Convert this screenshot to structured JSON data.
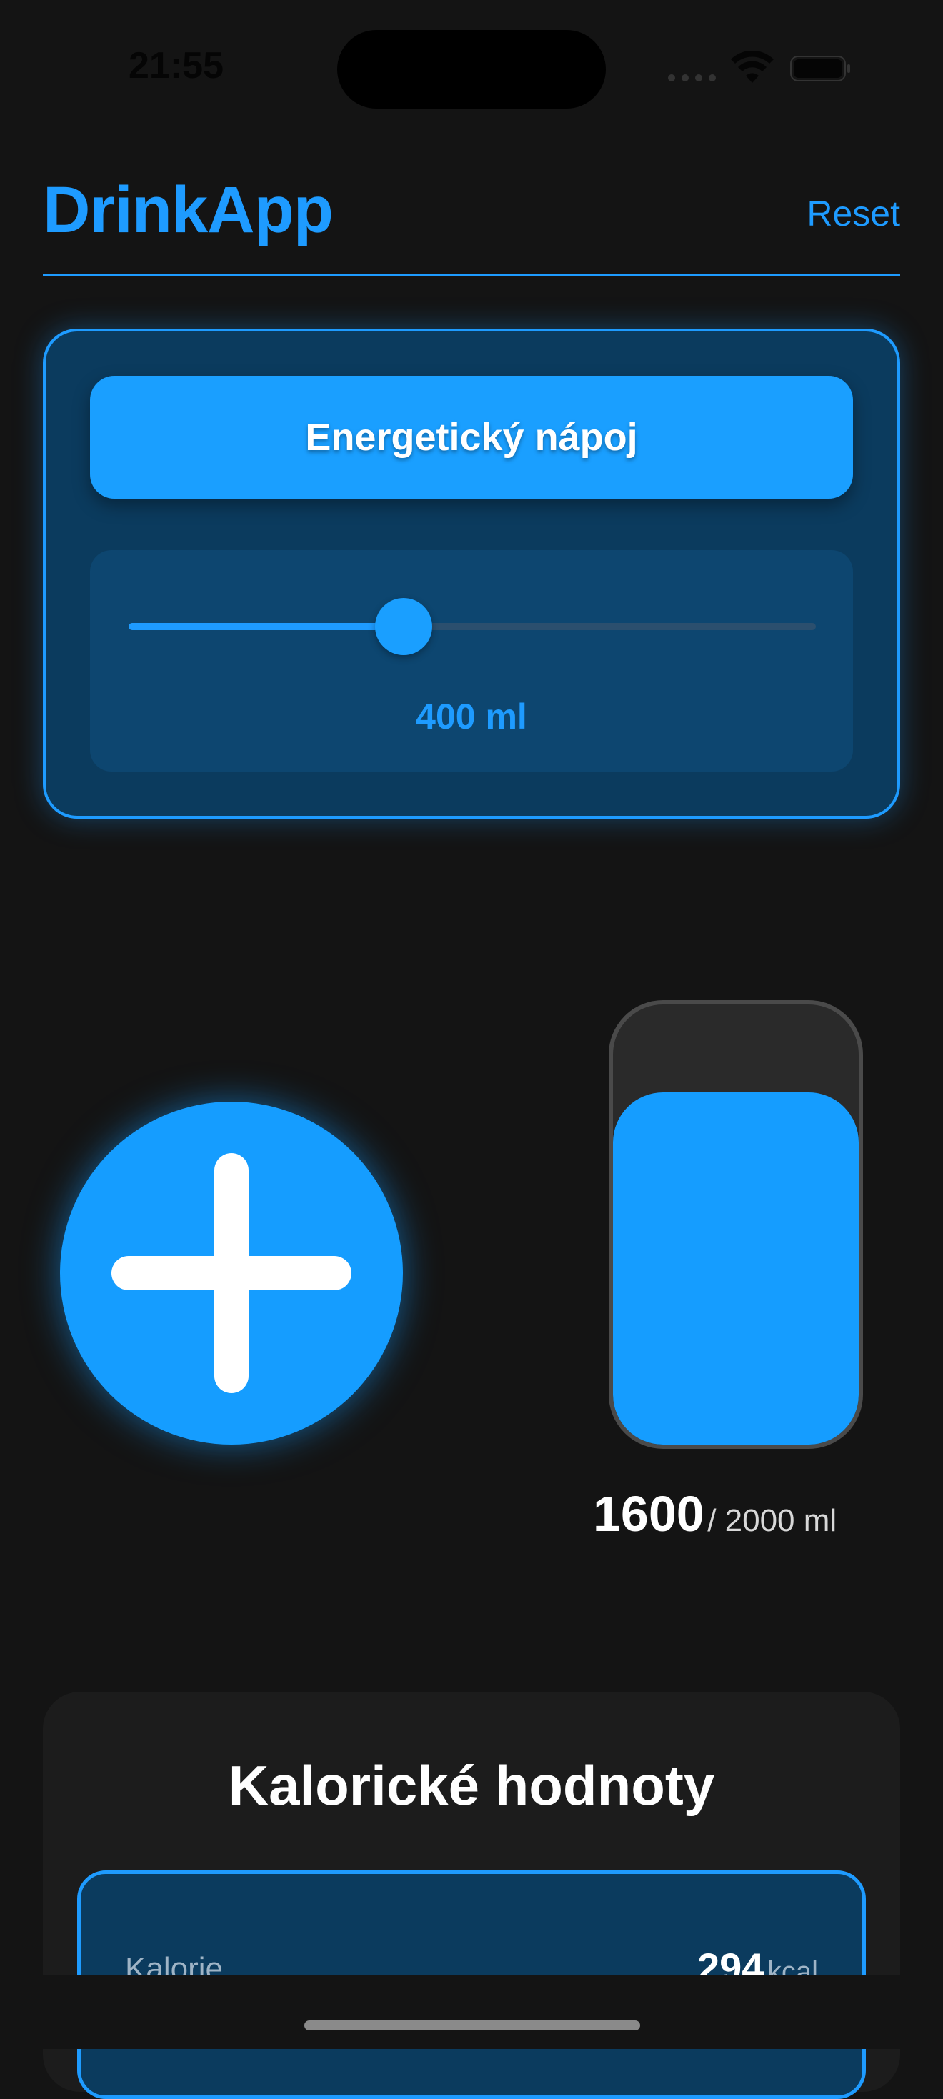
{
  "status_bar": {
    "time": "21:55"
  },
  "header": {
    "title": "DrinkApp",
    "reset_label": "Reset"
  },
  "drink_selector": {
    "drink_type": "Energetický nápoj",
    "slider_fraction": 0.4,
    "volume_label": "400 ml"
  },
  "intake": {
    "current": "1600",
    "goal": "/ 2000 ml",
    "fill_fraction": 0.8
  },
  "calories": {
    "title": "Kalorické hodnoty",
    "rows": [
      {
        "label": "Kalorie",
        "value": "294",
        "unit": "kcal"
      }
    ]
  },
  "colors": {
    "accent": "#1e9bff",
    "background": "#141414",
    "card": "#0b3b5e"
  }
}
